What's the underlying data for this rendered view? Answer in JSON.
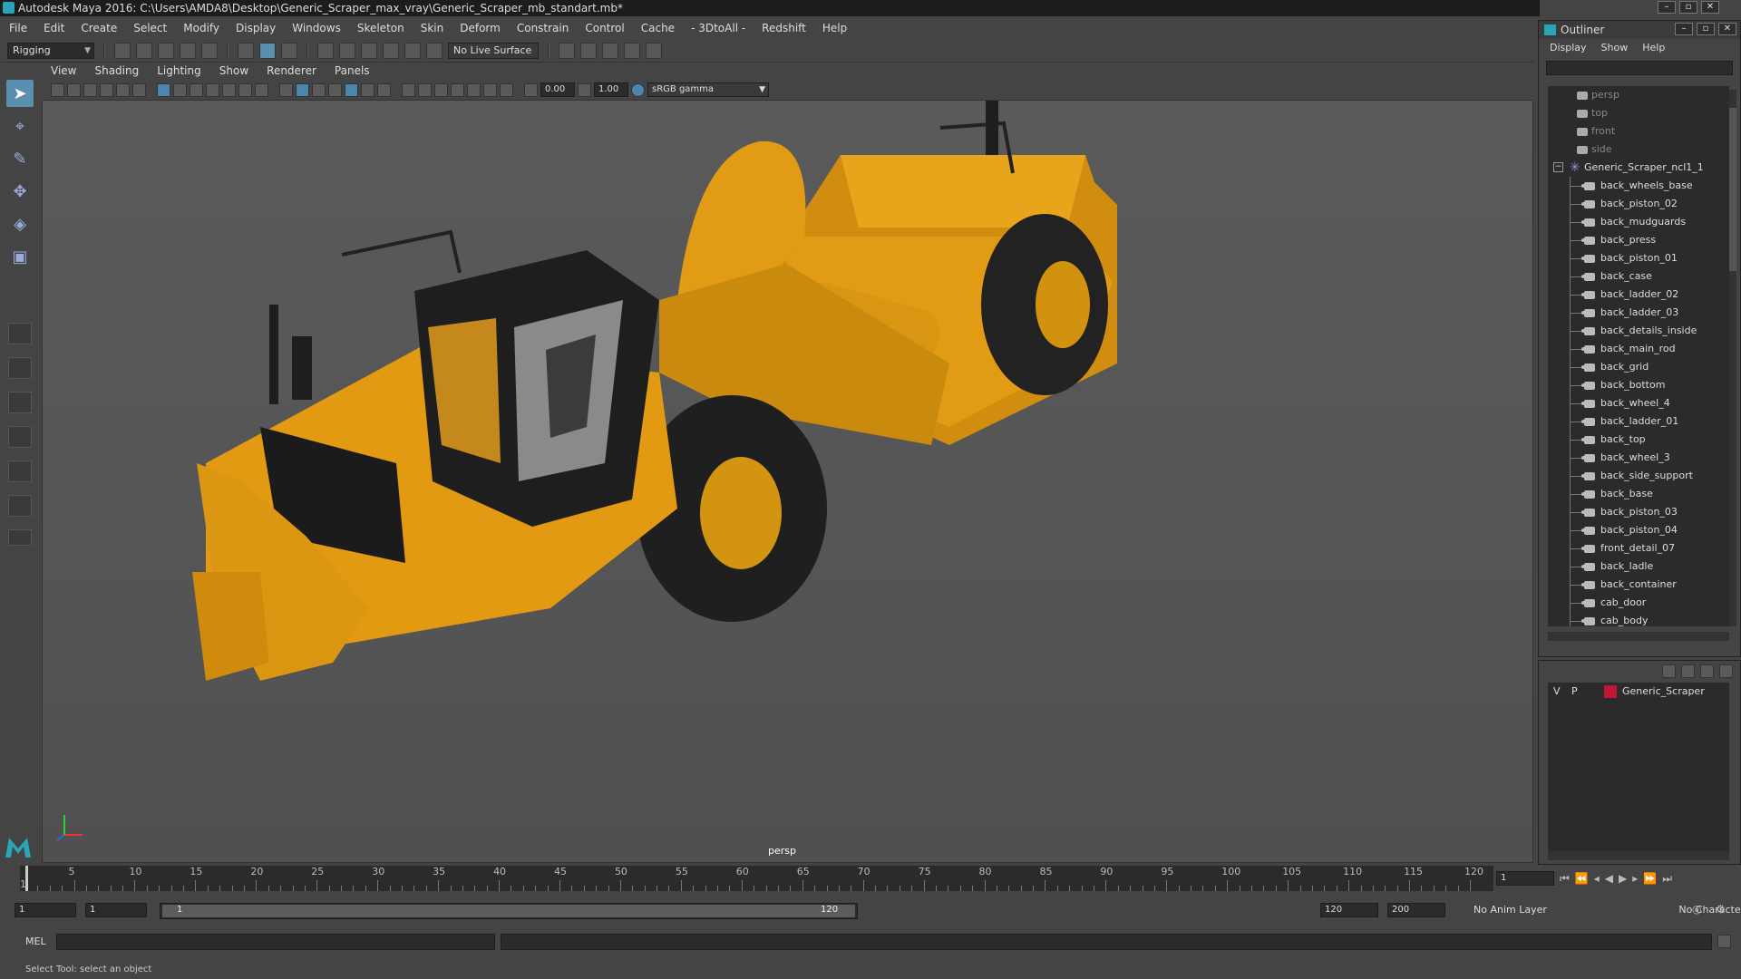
{
  "window": {
    "title": "Autodesk Maya 2016: C:\\Users\\AMDA8\\Desktop\\Generic_Scraper_max_vray\\Generic_Scraper_mb_standart.mb*"
  },
  "menubar": [
    "File",
    "Edit",
    "Create",
    "Select",
    "Modify",
    "Display",
    "Windows",
    "Skeleton",
    "Skin",
    "Deform",
    "Constrain",
    "Control",
    "Cache",
    "- 3DtoAll -",
    "Redshift",
    "Help"
  ],
  "shelf": {
    "mode": "Rigging",
    "live_surface": "No Live Surface"
  },
  "viewport": {
    "menu": [
      "View",
      "Shading",
      "Lighting",
      "Show",
      "Renderer",
      "Panels"
    ],
    "exposure": "0.00",
    "gamma": "1.00",
    "color_space": "sRGB gamma",
    "camera_label": "persp",
    "model_colors": {
      "body": "#e19a12",
      "dark": "#1e1e1e",
      "tire": "#262626"
    }
  },
  "outliner": {
    "title": "Outliner",
    "menu": [
      "Display",
      "Show",
      "Help"
    ],
    "cameras": [
      "persp",
      "top",
      "front",
      "side"
    ],
    "group": "Generic_Scraper_ncl1_1",
    "items": [
      "back_wheels_base",
      "back_piston_02",
      "back_mudguards",
      "back_press",
      "back_piston_01",
      "back_case",
      "back_ladder_02",
      "back_ladder_03",
      "back_details_inside",
      "back_main_rod",
      "back_grid",
      "back_bottom",
      "back_wheel_4",
      "back_ladder_01",
      "back_top",
      "back_wheel_3",
      "back_side_support",
      "back_base",
      "back_piston_03",
      "back_piston_04",
      "front_detail_07",
      "back_ladle",
      "back_container",
      "cab_door",
      "cab_body"
    ]
  },
  "layers": {
    "v": "V",
    "p": "P",
    "name": "Generic_Scraper",
    "color": "#c0163a"
  },
  "timeline": {
    "ticks": [
      "1",
      "5",
      "10",
      "15",
      "20",
      "25",
      "30",
      "35",
      "40",
      "45",
      "50",
      "55",
      "60",
      "65",
      "70",
      "75",
      "80",
      "85",
      "90",
      "95",
      "100",
      "105",
      "110",
      "115",
      "120"
    ],
    "current_frame": "1"
  },
  "range": {
    "start": "1",
    "playback_start": "1",
    "slider_start": "1",
    "slider_end": "120",
    "playback_end": "120",
    "end": "200",
    "anim_layer": "No Anim Layer",
    "character_set": "No Character Set"
  },
  "cmdline": {
    "lang": "MEL"
  },
  "help": "Select Tool: select an object"
}
